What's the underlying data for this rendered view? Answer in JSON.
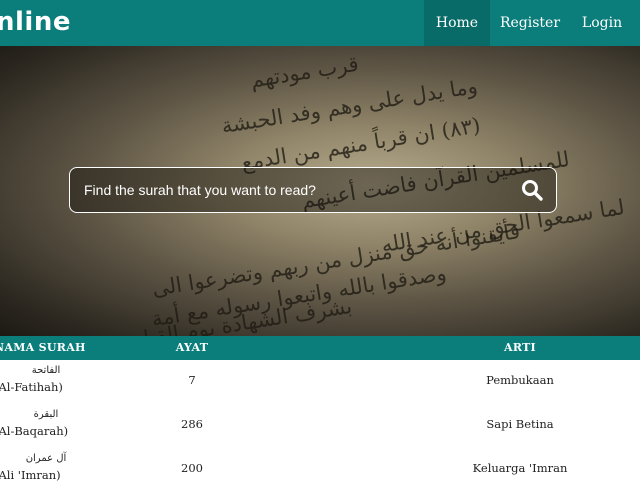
{
  "navbar": {
    "brand": "nline",
    "items": [
      {
        "label": "Home"
      },
      {
        "label": "Register"
      },
      {
        "label": "Login"
      }
    ]
  },
  "hero": {
    "search": {
      "placeholder": "Find the surah that you want to read?",
      "value": ""
    },
    "background_text": [
      "قرب مودتهم",
      "وما يدل على وهم وفد الحبشة",
      "(٨٣) ان قرباً منهم من الدمع",
      "للمسلمين القرآن فاضت أعينهم",
      "لما سمعوا الحق من عند الله",
      "فأيقنوا أنه حق منزل من ربهم وتضرعوا الى",
      "وصدقوا بالله واتبعوا رسوله مع أمة",
      "بشرف الشهادة يوم القيامة"
    ]
  },
  "table": {
    "headers": [
      "NAMA SURAH",
      "AYAT",
      "ARTI"
    ],
    "rows": [
      {
        "arabic": "الفاتحة",
        "latin": "(Al-Fatihah)",
        "ayat": "7",
        "arti": "Pembukaan"
      },
      {
        "arabic": "البقرة",
        "latin": "(Al-Baqarah)",
        "ayat": "286",
        "arti": "Sapi Betina"
      },
      {
        "arabic": "آل عمران",
        "latin": "(Ali 'Imran)",
        "ayat": "200",
        "arti": "Keluarga 'Imran"
      }
    ]
  },
  "colors": {
    "primary": "#0b7e7b",
    "active_nav": "#096b68"
  },
  "icons": {
    "search": "search-icon"
  }
}
